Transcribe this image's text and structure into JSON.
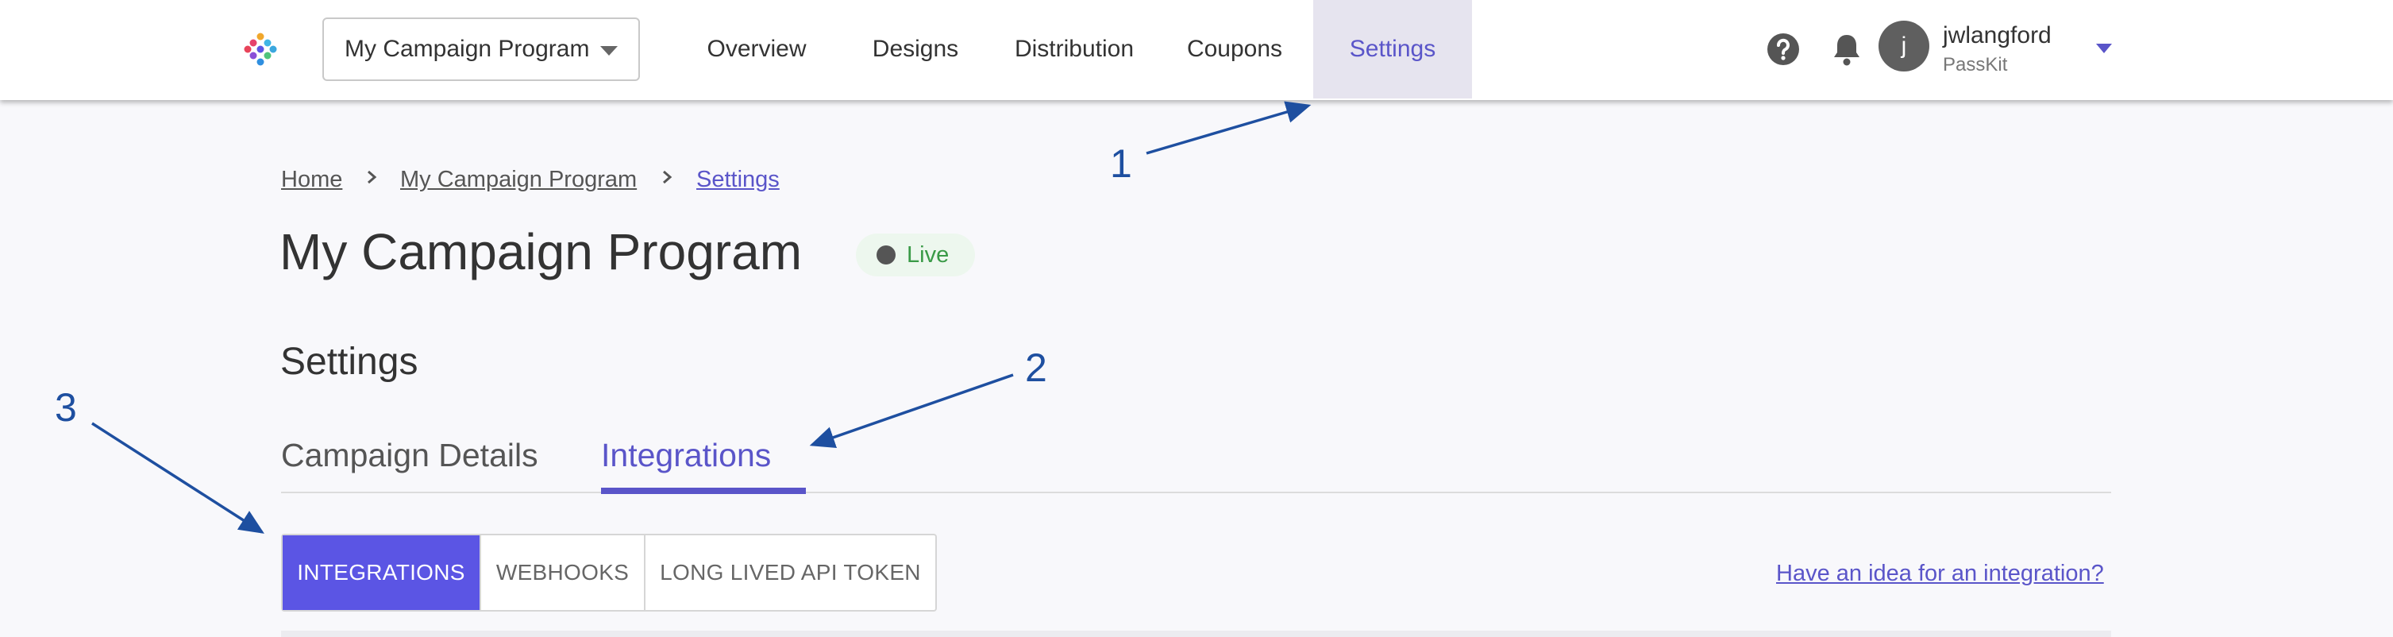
{
  "header": {
    "program_select": "My Campaign Program",
    "nav": [
      "Overview",
      "Designs",
      "Distribution",
      "Coupons",
      "Settings"
    ],
    "user": {
      "initial": "j",
      "name": "jwlangford",
      "org": "PassKit"
    }
  },
  "breadcrumb": {
    "home": "Home",
    "program": "My Campaign Program",
    "current": "Settings"
  },
  "page": {
    "title": "My Campaign Program",
    "status": "Live",
    "section_title": "Settings"
  },
  "tabs": {
    "details": "Campaign Details",
    "integrations": "Integrations",
    "active": "Integrations"
  },
  "subtabs": {
    "integrations": "INTEGRATIONS",
    "webhooks": "WEBHOOKS",
    "api_token": "LONG LIVED API TOKEN"
  },
  "idea_link": "Have an idea for an integration?",
  "annotations": [
    "1",
    "2",
    "3"
  ],
  "colors": {
    "accent": "#5a55c9",
    "active_subtab": "#5b55e4",
    "live_green": "#3a9a47",
    "annotation_blue": "#1e4fa0"
  }
}
